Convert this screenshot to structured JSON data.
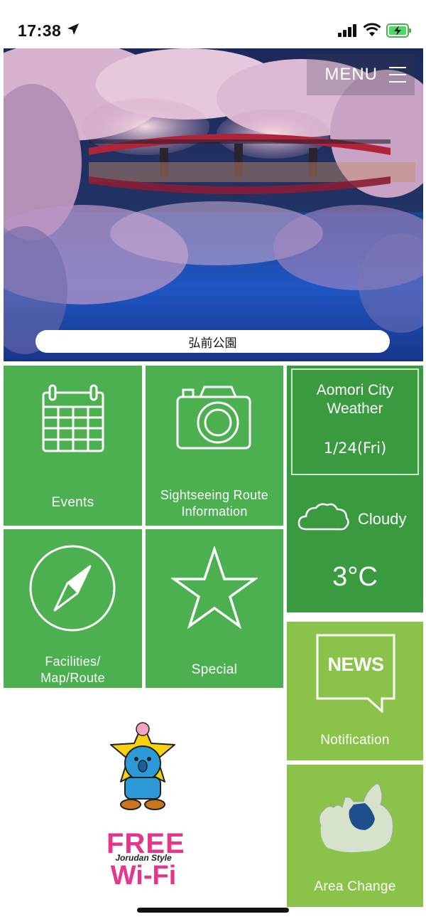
{
  "status_bar": {
    "time": "17:38",
    "icons": [
      "location-arrow-icon",
      "cellular-signal-icon",
      "wifi-icon",
      "battery-charging-icon"
    ]
  },
  "hero": {
    "menu_label": "MENU",
    "caption": "弘前公園"
  },
  "tiles": {
    "events": {
      "label": "Events",
      "icon": "calendar-icon"
    },
    "sightseeing": {
      "label_line1": "Sightseeing Route",
      "label_line2": "Information",
      "icon": "camera-icon"
    },
    "facilities": {
      "label_line1": "Facilities/",
      "label_line2": "Map/Route",
      "icon": "compass-icon"
    },
    "special": {
      "label": "Special",
      "icon": "star-icon"
    },
    "notification": {
      "label": "Notification",
      "icon_text": "NEWS",
      "icon": "news-bubble-icon"
    },
    "area_change": {
      "label": "Area Change",
      "icon": "aomori-map-icon"
    }
  },
  "weather": {
    "city_line1": "Aomori City",
    "city_line2": "Weather",
    "date": "1/24(Fri)",
    "condition": "Cloudy",
    "temperature": "3°C",
    "icon": "cloud-icon"
  },
  "promo": {
    "wifi_line1": "FREE",
    "wifi_brand": "Jorudan Style",
    "wifi_line2": "Wi-Fi"
  },
  "colors": {
    "tile_green": "#4caf50",
    "weather_green": "#3a9a3f",
    "news_green": "#8bc34a"
  }
}
